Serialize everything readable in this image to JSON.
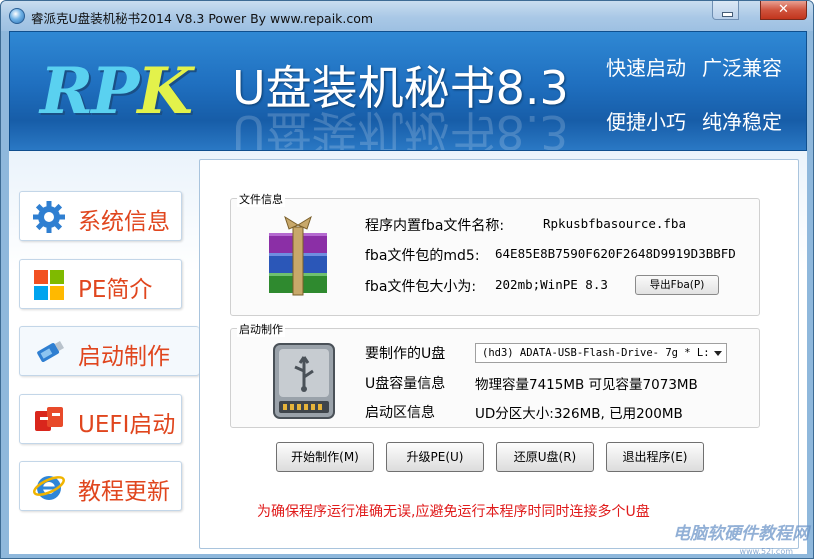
{
  "window": {
    "title": "睿派克U盘装机秘书2014 V8.3 Power By www.repaik.com",
    "close_label": "✕"
  },
  "banner": {
    "logo_rp": "RP",
    "logo_k": "K",
    "product": "U盘装机秘书8.3",
    "slogans": [
      "快速启动",
      "广泛兼容",
      "便捷小巧",
      "纯净稳定"
    ]
  },
  "nav": [
    {
      "label": "系统信息",
      "icon": "gear-icon"
    },
    {
      "label": "PE简介",
      "icon": "windows-logo-icon"
    },
    {
      "label": "启动制作",
      "icon": "usb-drive-icon",
      "active": true
    },
    {
      "label": "UEFI启动",
      "icon": "uefi-logo-icon"
    },
    {
      "label": "教程更新",
      "icon": "ie-browser-icon"
    }
  ],
  "file_info": {
    "legend": "文件信息",
    "name_label": "程序内置fba文件名称:",
    "name_value": "Rpkusbfbasource.fba",
    "md5_label": "fba文件包的md5:",
    "md5_value": "64E85E8B7590F620F2648D9919D3BBFD",
    "size_label": "fba文件包大小为:",
    "size_value": "202mb;WinPE 8.3",
    "export_button": "导出Fba(P)"
  },
  "boot": {
    "legend": "启动制作",
    "disk_label": "要制作的U盘",
    "disk_selected": "(hd3) ADATA-USB-Flash-Drive- 7g * L:",
    "capacity_label": "U盘容量信息",
    "capacity_value": "物理容量7415MB 可见容量7073MB",
    "boot_label": "启动区信息",
    "boot_value": "UD分区大小:326MB, 已用200MB"
  },
  "actions": [
    "开始制作(M)",
    "升级PE(U)",
    "还原U盘(R)",
    "退出程序(E)"
  ],
  "warning": "为确保程序运行准确无误,应避免运行本程序时同时连接多个U盘",
  "watermark": "电脑软硬件教程网",
  "watermark_sub": "www.52i.com"
}
